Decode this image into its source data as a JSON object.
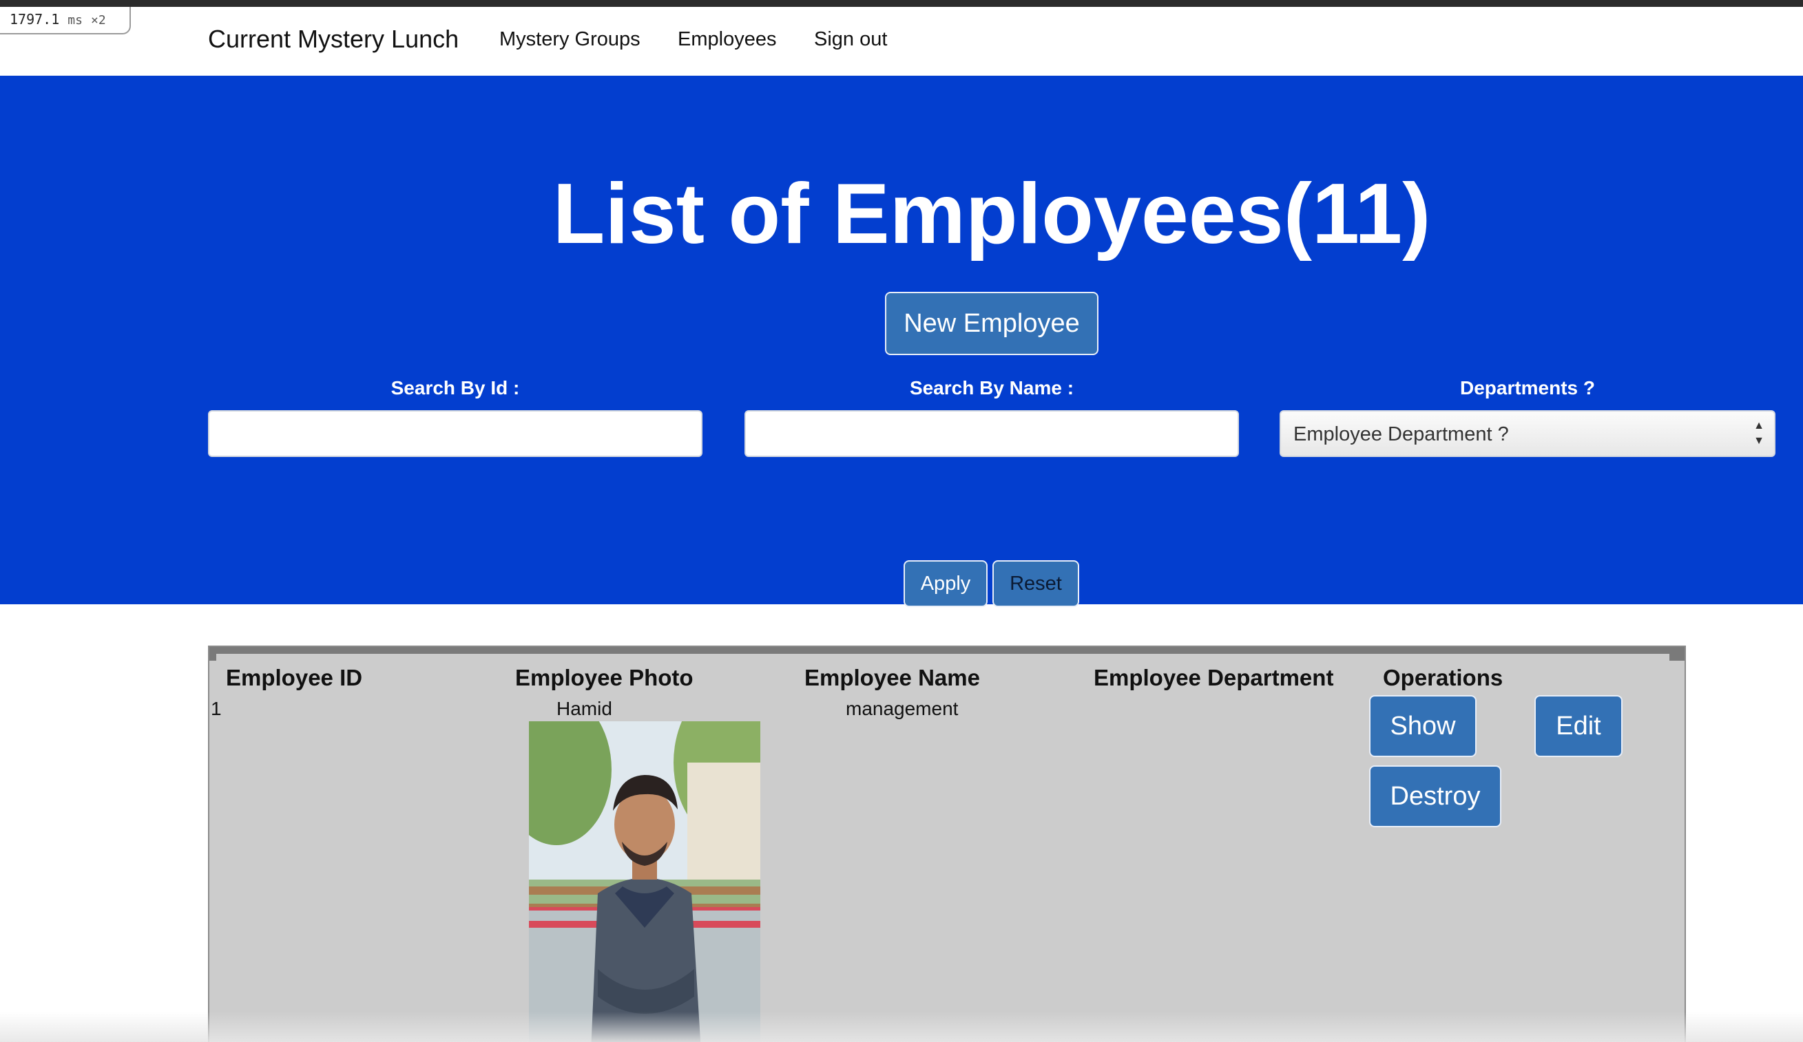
{
  "perf_badge": {
    "time": "1797.1",
    "unit": "ms",
    "multiplier": "×2"
  },
  "navbar": {
    "brand": "Current Mystery Lunch",
    "links": [
      "Mystery Groups",
      "Employees",
      "Sign out"
    ]
  },
  "hero": {
    "title": "List of Employees(11)",
    "new_button": "New Employee",
    "search_id_label": "Search By Id :",
    "search_id_value": "",
    "search_name_label": "Search By Name :",
    "search_name_value": "",
    "departments_label": "Departments ?",
    "department_selected": "Employee Department ?",
    "apply_button": "Apply",
    "reset_button": "Reset",
    "background_color": "#033ecf",
    "button_color": "#3371b5"
  },
  "table": {
    "headers": [
      "Employee ID",
      "Employee Photo",
      "Employee Name",
      "Employee Department",
      "Operations"
    ],
    "rows": [
      {
        "id": "1",
        "photo": "employee-photo",
        "name": "Hamid",
        "department": "management",
        "operations": [
          "Show",
          "Edit",
          "Destroy"
        ]
      }
    ]
  }
}
